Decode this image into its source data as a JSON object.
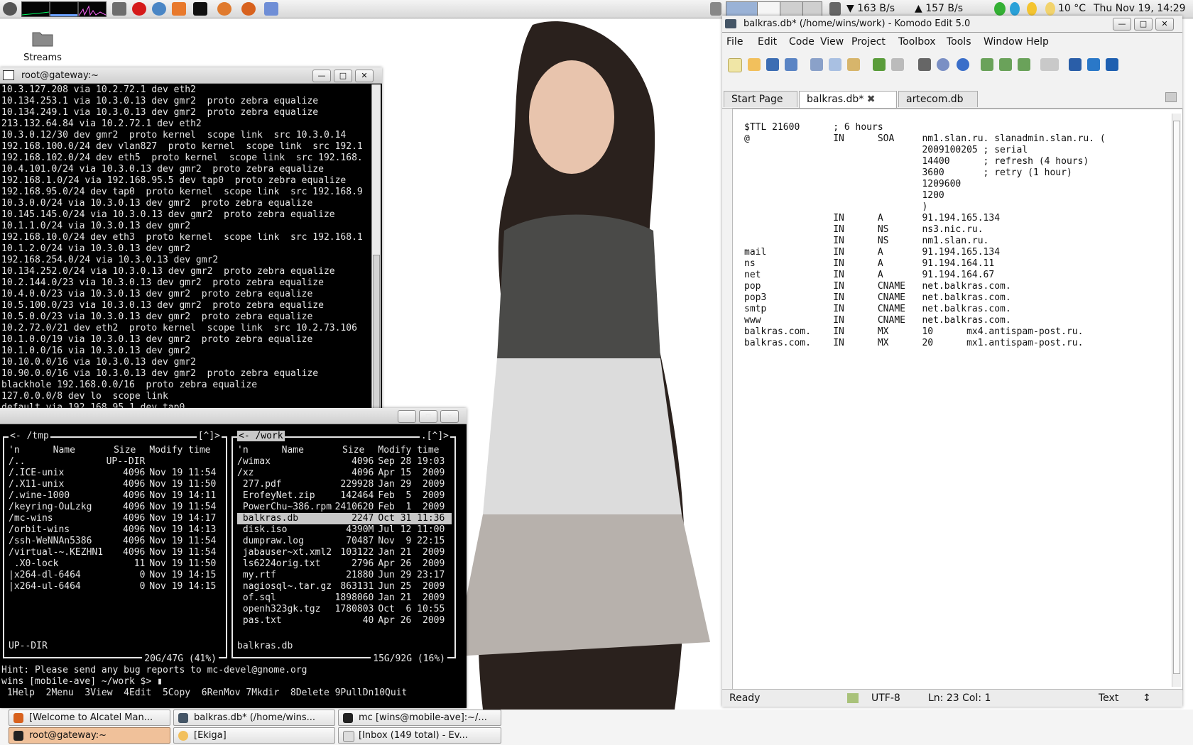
{
  "top_panel": {
    "net_down": "163 B/s",
    "net_up": "157 B/s",
    "weather": "10 °C",
    "clock": "Thu Nov 19, 14:29",
    "launchers": [
      "gnome-foot-icon",
      "cpu-monitor",
      "mem-monitor",
      "net-monitor",
      "calculator-icon",
      "opera-icon",
      "pidgin-icon",
      "game-icon",
      "terminal-icon",
      "ubuntu-icon",
      "firefox-icon",
      "feather-icon"
    ]
  },
  "desktop": {
    "folder_label": "Streams"
  },
  "terminal": {
    "title": "root@gateway:~",
    "lines": [
      "10.3.127.208 via 10.2.72.1 dev eth2",
      "10.134.253.1 via 10.3.0.13 dev gmr2  proto zebra equalize",
      "10.134.249.1 via 10.3.0.13 dev gmr2  proto zebra equalize",
      "213.132.64.84 via 10.2.72.1 dev eth2",
      "10.3.0.12/30 dev gmr2  proto kernel  scope link  src 10.3.0.14",
      "192.168.100.0/24 dev vlan827  proto kernel  scope link  src 192.1",
      "192.168.102.0/24 dev eth5  proto kernel  scope link  src 192.168.",
      "10.4.101.0/24 via 10.3.0.13 dev gmr2  proto zebra equalize",
      "192.168.1.0/24 via 192.168.95.5 dev tap0  proto zebra equalize",
      "192.168.95.0/24 dev tap0  proto kernel  scope link  src 192.168.9",
      "10.3.0.0/24 via 10.3.0.13 dev gmr2  proto zebra equalize",
      "10.145.145.0/24 via 10.3.0.13 dev gmr2  proto zebra equalize",
      "10.1.1.0/24 via 10.3.0.13 dev gmr2",
      "192.168.10.0/24 dev eth3  proto kernel  scope link  src 192.168.1",
      "10.1.2.0/24 via 10.3.0.13 dev gmr2",
      "192.168.254.0/24 via 10.3.0.13 dev gmr2",
      "10.134.252.0/24 via 10.3.0.13 dev gmr2  proto zebra equalize",
      "10.2.144.0/23 via 10.3.0.13 dev gmr2  proto zebra equalize",
      "10.4.0.0/23 via 10.3.0.13 dev gmr2  proto zebra equalize",
      "10.5.100.0/23 via 10.3.0.13 dev gmr2  proto zebra equalize",
      "10.5.0.0/23 via 10.3.0.13 dev gmr2  proto zebra equalize",
      "10.2.72.0/21 dev eth2  proto kernel  scope link  src 10.2.73.106",
      "10.1.0.0/19 via 10.3.0.13 dev gmr2  proto zebra equalize",
      "10.1.0.0/16 via 10.3.0.13 dev gmr2",
      "10.10.0.0/16 via 10.3.0.13 dev gmr2",
      "10.90.0.0/16 via 10.3.0.13 dev gmr2  proto zebra equalize",
      "blackhole 192.168.0.0/16  proto zebra equalize",
      "127.0.0.0/8 dev lo  scope link",
      "default via 192.168.95.1 dev tap0"
    ],
    "prompt_host": "gateway",
    "prompt_path": "~ #"
  },
  "mc": {
    "left_panel": {
      "path": "/tmp",
      "corner": "[^]>",
      "headers": [
        "'n",
        "Name",
        "Size",
        "Modify time"
      ],
      "rows": [
        [
          "/..",
          "UP--DIR",
          ""
        ],
        [
          "/.ICE-unix",
          "4096",
          "Nov 19 11:54"
        ],
        [
          "/.X11-unix",
          "4096",
          "Nov 19 11:50"
        ],
        [
          "/.wine-1000",
          "4096",
          "Nov 19 14:11"
        ],
        [
          "/keyring-OuLzkg",
          "4096",
          "Nov 19 11:54"
        ],
        [
          "/mc-wins",
          "4096",
          "Nov 19 14:17"
        ],
        [
          "/orbit-wins",
          "4096",
          "Nov 19 14:13"
        ],
        [
          "/ssh-WeNNAn5386",
          "4096",
          "Nov 19 11:54"
        ],
        [
          "/virtual-~.KEZHN1",
          "4096",
          "Nov 19 11:54"
        ],
        [
          " .X0-lock",
          "11",
          "Nov 19 11:50"
        ],
        [
          "|x264-dl-6464",
          "0",
          "Nov 19 14:15"
        ],
        [
          "|x264-ul-6464",
          "0",
          "Nov 19 14:15"
        ]
      ],
      "selected_info": "UP--DIR",
      "free": "20G/47G (41%)"
    },
    "right_panel": {
      "path": "/work",
      "corner": ".[^]>",
      "headers": [
        "'n",
        "Name",
        "Size",
        "Modify time"
      ],
      "rows": [
        [
          "/wimax",
          "4096",
          "Sep 28 19:03"
        ],
        [
          "/xz",
          "4096",
          "Apr 15  2009"
        ],
        [
          " 277.pdf",
          "229928",
          "Jan 29  2009"
        ],
        [
          " ErofeyNet.zip",
          "142464",
          "Feb  5  2009"
        ],
        [
          " PowerChu~386.rpm",
          "2410620",
          "Feb  1  2009"
        ],
        [
          " balkras.db",
          "2247",
          "Oct 31 11:36"
        ],
        [
          " disk.iso",
          "4390M",
          "Jul 12 11:00"
        ],
        [
          " dumpraw.log",
          "70487",
          "Nov  9 22:15"
        ],
        [
          " jabauser~xt.xml2",
          "103122",
          "Jan 21  2009"
        ],
        [
          " ls6224orig.txt",
          "2796",
          "Apr 26  2009"
        ],
        [
          " my.rtf",
          "21880",
          "Jun 29 23:17"
        ],
        [
          " nagiosql~.tar.gz",
          "863131",
          "Jun 25  2009"
        ],
        [
          " of.sql",
          "1898060",
          "Jan 21  2009"
        ],
        [
          " openh323gk.tgz",
          "1780803",
          "Oct  6 10:55"
        ],
        [
          " pas.txt",
          "40",
          "Apr 26  2009"
        ]
      ],
      "selected_index": 5,
      "selected_info": "balkras.db",
      "free": "15G/92G (16%)"
    },
    "hint": "Hint: Please send any bug reports to mc-devel@gnome.org",
    "cmdline": "wins [mobile-ave] ~/work $>",
    "fkeys": " 1Help  2Menu  3View  4Edit  5Copy  6RenMov 7Mkdir  8Delete 9PullDn10Quit"
  },
  "komodo": {
    "title": "balkras.db* (/home/wins/work) - Komodo Edit 5.0",
    "menu": [
      "File",
      "Edit",
      "Code",
      "View",
      "Project",
      "Toolbox",
      "Tools",
      "Window",
      "Help"
    ],
    "tabs": [
      "Start Page",
      "balkras.db*",
      "artecom.db"
    ],
    "active_tab": 1,
    "code": [
      "$TTL 21600      ; 6 hours",
      "@               IN      SOA     nm1.slan.ru. slanadmin.slan.ru. (",
      "                                2009100205 ; serial",
      "                                14400      ; refresh (4 hours)",
      "                                3600       ; retry (1 hour)",
      "                                1209600",
      "                                1200",
      "                                )",
      "                IN      A       91.194.165.134",
      "                IN      NS      ns3.nic.ru.",
      "                IN      NS      nm1.slan.ru.",
      "mail            IN      A       91.194.165.134",
      "ns              IN      A       91.194.164.11",
      "net             IN      A       91.194.164.67",
      "pop             IN      CNAME   net.balkras.com.",
      "pop3            IN      CNAME   net.balkras.com.",
      "smtp            IN      CNAME   net.balkras.com.",
      "www             IN      CNAME   net.balkras.com.",
      "balkras.com.    IN      MX      10      mx4.antispam-post.ru.",
      "balkras.com.    IN      MX      20      mx1.antispam-post.ru."
    ],
    "status": {
      "state": "Ready",
      "encoding": "UTF-8",
      "position": "Ln: 23 Col: 1",
      "mode": "Text"
    }
  },
  "taskbar": [
    {
      "label": "[Welcome to Alcatel Man...",
      "active": false
    },
    {
      "label": "balkras.db* (/home/wins...",
      "active": false
    },
    {
      "label": "mc [wins@mobile-ave]:~/...",
      "active": false
    },
    {
      "label": "root@gateway:~",
      "active": true
    },
    {
      "label": "[Ekiga]",
      "active": false
    },
    {
      "label": "[Inbox (149 total) - Ev...",
      "active": false
    }
  ]
}
